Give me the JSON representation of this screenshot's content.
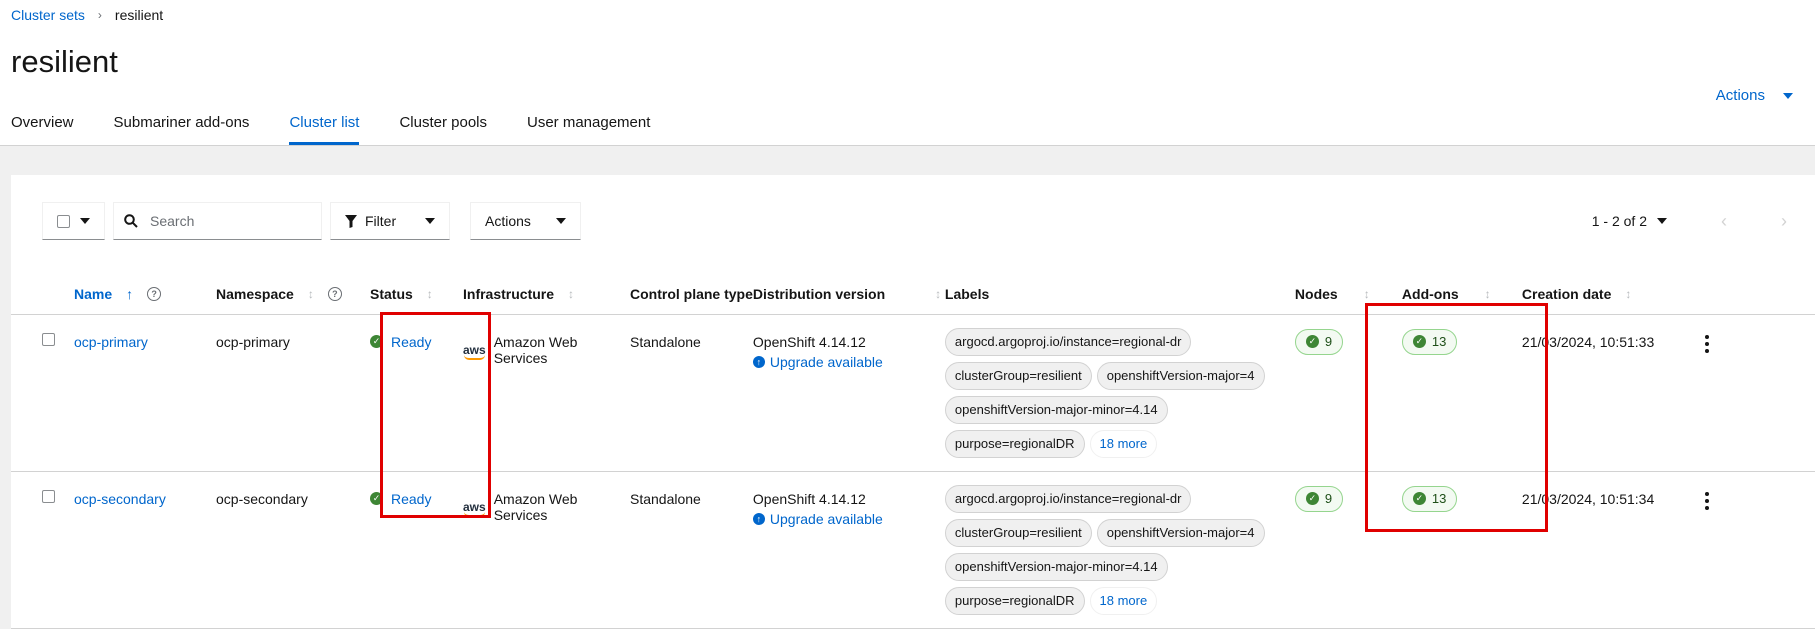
{
  "breadcrumb": {
    "parent": "Cluster sets",
    "current": "resilient"
  },
  "page_title": "resilient",
  "header_actions": "Actions",
  "tabs": [
    {
      "label": "Overview",
      "active": false
    },
    {
      "label": "Submariner add-ons",
      "active": false
    },
    {
      "label": "Cluster list",
      "active": true
    },
    {
      "label": "Cluster pools",
      "active": false
    },
    {
      "label": "User management",
      "active": false
    }
  ],
  "toolbar": {
    "search_placeholder": "Search",
    "filter_label": "Filter",
    "actions_label": "Actions"
  },
  "pagination": {
    "range": "1 - 2",
    "of": "of 2",
    "prev_icon": "angle-left-icon",
    "next_icon": "angle-right-icon"
  },
  "columns": {
    "name": "Name",
    "namespace": "Namespace",
    "status": "Status",
    "infrastructure": "Infrastructure",
    "control_plane": "Control plane type",
    "distribution": "Distribution version",
    "labels": "Labels",
    "nodes": "Nodes",
    "addons": "Add-ons",
    "creation": "Creation date"
  },
  "rows": [
    {
      "name": "ocp-primary",
      "namespace": "ocp-primary",
      "status": "Ready",
      "infrastructure": "Amazon Web Services",
      "infra_logo": "aws",
      "control_plane": "Standalone",
      "distribution": "OpenShift 4.14.12",
      "upgrade": "Upgrade available",
      "labels": [
        "argocd.argoproj.io/instance=regional-dr",
        "clusterGroup=resilient",
        "openshiftVersion-major=4",
        "openshiftVersion-major-minor=4.14",
        "purpose=regionalDR"
      ],
      "more": "18 more",
      "nodes": "9",
      "addons": "13",
      "creation": "21/03/2024, 10:51:33"
    },
    {
      "name": "ocp-secondary",
      "namespace": "ocp-secondary",
      "status": "Ready",
      "infrastructure": "Amazon Web Services",
      "infra_logo": "aws",
      "control_plane": "Standalone",
      "distribution": "OpenShift 4.14.12",
      "upgrade": "Upgrade available",
      "labels": [
        "argocd.argoproj.io/instance=regional-dr",
        "clusterGroup=resilient",
        "openshiftVersion-major=4",
        "openshiftVersion-major-minor=4.14",
        "purpose=regionalDR"
      ],
      "more": "18 more",
      "nodes": "9",
      "addons": "13",
      "creation": "21/03/2024, 10:51:34"
    }
  ],
  "colors": {
    "link": "#0066cc",
    "success": "#3e8635",
    "highlight": "#e00000"
  }
}
